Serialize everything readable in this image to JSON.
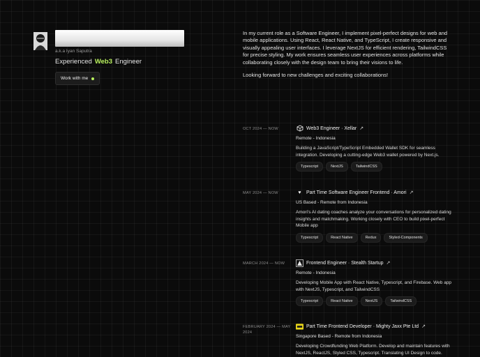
{
  "profile": {
    "aka": "a.k.a Iyan Saputra",
    "role_prefix": "Experienced",
    "role_highlight": "Web3",
    "role_suffix": "Engineer",
    "cta_label": "Work with me",
    "accent_color": "#b9f15e"
  },
  "bio": {
    "paragraph1": "In my current role as a Software Engineer, I implement pixel-perfect designs for web and mobile applications. Using React, React Native, and TypeScript, I create responsive and visually appealing user interfaces. I leverage NextJS for efficient rendering, TailwindCSS for precise styling. My work ensures seamless user experiences across platforms while collaborating closely with the design team to bring their visions to life.",
    "paragraph2": "Looking forward to new challenges and exciting collaborations!"
  },
  "experiences": [
    {
      "date": "OCT 2024 — NOW",
      "title": "Web3 Engineer · Xellar",
      "logo": "cube-icon",
      "location": "Remote - Indonesia",
      "description": "Building a JavaScript/TypeScript Embedded Wallet SDK for seamless integration. Developing a cutting-edge Web3 wallet powered by Next.js.",
      "tags": [
        "Typescript",
        "NextJS",
        "TailwindCSS"
      ]
    },
    {
      "date": "MAY 2024 — NOW",
      "title": "Part Time Software Engineer Frontend · Amori",
      "logo": "heart-icon",
      "location": "US Based - Remote from Indonesia",
      "description": "Amori's AI dating coaches analyze your conversations for personalized dating insights and matchmaking. Working closely with CEO to build pixel-perfect Mobile app",
      "tags": [
        "Typescript",
        "React Native",
        "Redux",
        "Styled-Components"
      ]
    },
    {
      "date": "MARCH 2024 — NOW",
      "title": "Frontend Engineer · Stealth Startup",
      "logo": "stealth-icon",
      "location": "Remote - Indonesia",
      "description": "Developing Mobile App with React Native, Typescript, and Firebase. Web app with NextJS, Typescript, and TailwindCSS",
      "tags": [
        "Typescript",
        "React Native",
        "NextJS",
        "TailwindCSS"
      ]
    },
    {
      "date": "FEBRUARY 2024 — MAY 2024",
      "title": "Part Time Frontend Developer · Mighty Jaxx Pte Ltd",
      "logo": "mightyjaxx-icon",
      "location": "Singapore Based - Remote from Indonesia",
      "description": "Developing Crowdfunding Web Platform. Develop and maintain features with NextJS, ReactJS, Styled CSS, Typescript. Translating UI Design to code.",
      "tags": []
    }
  ]
}
